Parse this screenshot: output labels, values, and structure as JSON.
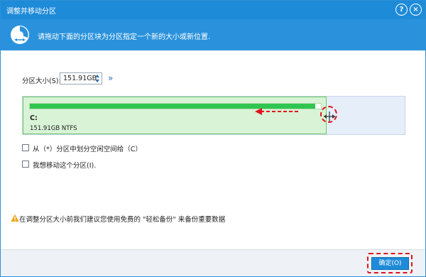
{
  "window": {
    "title": "调整并移动分区",
    "help_glyph": "?",
    "close_glyph": "×"
  },
  "banner": {
    "icon": "resize-partition-icon",
    "text": "请拖动下面的分区块为分区指定一个新的大小或新位置."
  },
  "size": {
    "label": "分区大小(S):",
    "value": "151.91GB",
    "expand_glyph": "»"
  },
  "partition": {
    "letter": "C:",
    "info": "151.91GB NTFS",
    "used_fraction": 0.98,
    "fill_color": "#2fc54f",
    "block_color": "#d8f3d5",
    "free_area_color": "#e6eef9"
  },
  "options": [
    {
      "label": "从（*）分区中划分空闲空间给（C）",
      "checked": false
    },
    {
      "label": "我想移动这个分区(I).",
      "checked": false
    }
  ],
  "warning": {
    "icon": "warning-icon",
    "text": "在调整分区大小前我们建议您使用免费的 \"轻松备份\" 来备份重要数据"
  },
  "footer": {
    "ok_label": "确定(O)"
  },
  "colors": {
    "accent": "#1e8bd8",
    "highlight": "#e0131b"
  }
}
